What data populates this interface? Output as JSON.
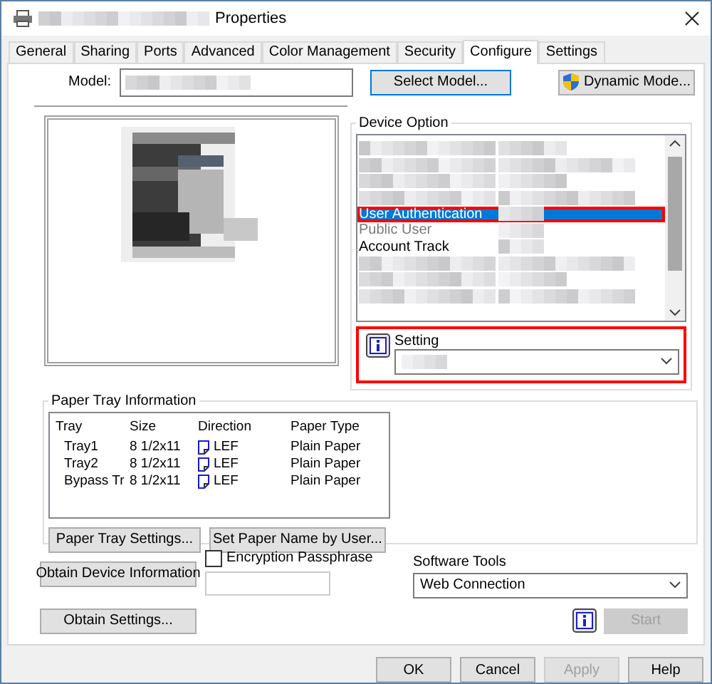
{
  "window": {
    "title": "Properties"
  },
  "tabs": [
    {
      "label": "General",
      "selected": false
    },
    {
      "label": "Sharing",
      "selected": false
    },
    {
      "label": "Ports",
      "selected": false
    },
    {
      "label": "Advanced",
      "selected": false
    },
    {
      "label": "Color Management",
      "selected": false
    },
    {
      "label": "Security",
      "selected": false
    },
    {
      "label": "Configure",
      "selected": true
    },
    {
      "label": "Settings",
      "selected": false
    }
  ],
  "model": {
    "label": "Model:",
    "select_button": "Select Model...",
    "dynamic_button": "Dynamic Mode..."
  },
  "device_option": {
    "title": "Device Option",
    "items": [
      {
        "kind": "redacted"
      },
      {
        "kind": "redacted"
      },
      {
        "kind": "redacted"
      },
      {
        "kind": "redacted"
      },
      {
        "kind": "option",
        "label": "User Authentication",
        "selected": true,
        "disabled": false
      },
      {
        "kind": "option",
        "label": "Public User",
        "selected": false,
        "disabled": true
      },
      {
        "kind": "option",
        "label": "Account Track",
        "selected": false,
        "disabled": false
      },
      {
        "kind": "redacted"
      },
      {
        "kind": "redacted"
      },
      {
        "kind": "redacted"
      }
    ]
  },
  "setting": {
    "label": "Setting"
  },
  "paper_tray": {
    "title": "Paper Tray Information",
    "columns": [
      "Tray",
      "Size",
      "Direction",
      "Paper Type"
    ],
    "rows": [
      {
        "tray": "Tray1",
        "size": "8 1/2x11",
        "direction": "LEF",
        "paper_type": "Plain Paper"
      },
      {
        "tray": "Tray2",
        "size": "8 1/2x11",
        "direction": "LEF",
        "paper_type": "Plain Paper"
      },
      {
        "tray": "Bypass Tr",
        "size": "8 1/2x11",
        "direction": "LEF",
        "paper_type": "Plain Paper"
      }
    ],
    "buttons": [
      "Paper Tray Settings...",
      "Set Paper Name by User..."
    ]
  },
  "obtain_device_button": "Obtain Device Information",
  "obtain_settings_button": "Obtain Settings...",
  "encryption": {
    "label": "Encryption Passphrase",
    "checked": false
  },
  "software_tools": {
    "label": "Software Tools",
    "value": "Web Connection"
  },
  "start_button": {
    "label": "Start",
    "disabled": true
  },
  "footer_buttons": [
    {
      "label": "OK",
      "disabled": false
    },
    {
      "label": "Cancel",
      "disabled": false
    },
    {
      "label": "Apply",
      "disabled": true
    },
    {
      "label": "Help",
      "disabled": false
    }
  ]
}
